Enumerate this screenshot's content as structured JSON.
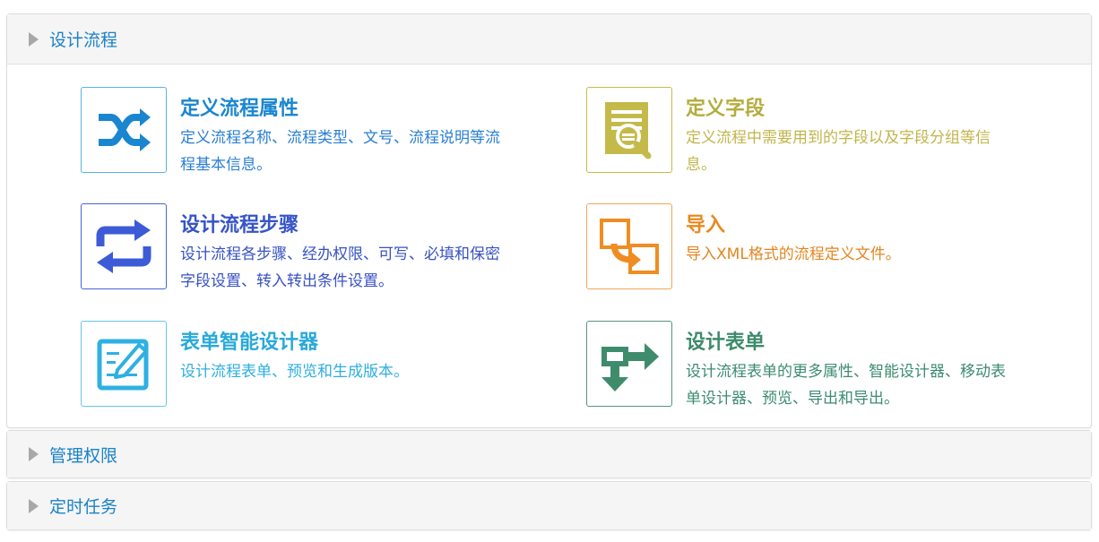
{
  "sections": [
    {
      "label": "设计流程",
      "expanded": true
    },
    {
      "label": "管理权限",
      "expanded": false
    },
    {
      "label": "定时任务",
      "expanded": false
    }
  ],
  "cards": [
    {
      "title": "定义流程属性",
      "desc": "定义流程名称、流程类型、文号、流程说明等流程基本信息。",
      "icon": "shuffle-icon",
      "color": "#1a86cf"
    },
    {
      "title": "定义字段",
      "desc": "定义流程中需要用到的字段以及字段分组等信息。",
      "icon": "document-search-icon",
      "color": "#b3ad3e"
    },
    {
      "title": "设计流程步骤",
      "desc": "设计流程各步骤、经办权限、可写、必填和保密字段设置、转入转出条件设置。",
      "icon": "repeat-icon",
      "color": "#3654c7"
    },
    {
      "title": "导入",
      "desc": "导入XML格式的流程定义文件。",
      "icon": "import-icon",
      "color": "#e88a1e"
    },
    {
      "title": "表单智能设计器",
      "desc": "设计流程表单、预览和生成版本。",
      "icon": "form-edit-icon",
      "color": "#29a9d9"
    },
    {
      "title": "设计表单",
      "desc": "设计流程表单的更多属性、智能设计器、移动表单设计器、预览、导出和导出。",
      "icon": "form-transfer-icon",
      "color": "#3d8a6c"
    }
  ]
}
